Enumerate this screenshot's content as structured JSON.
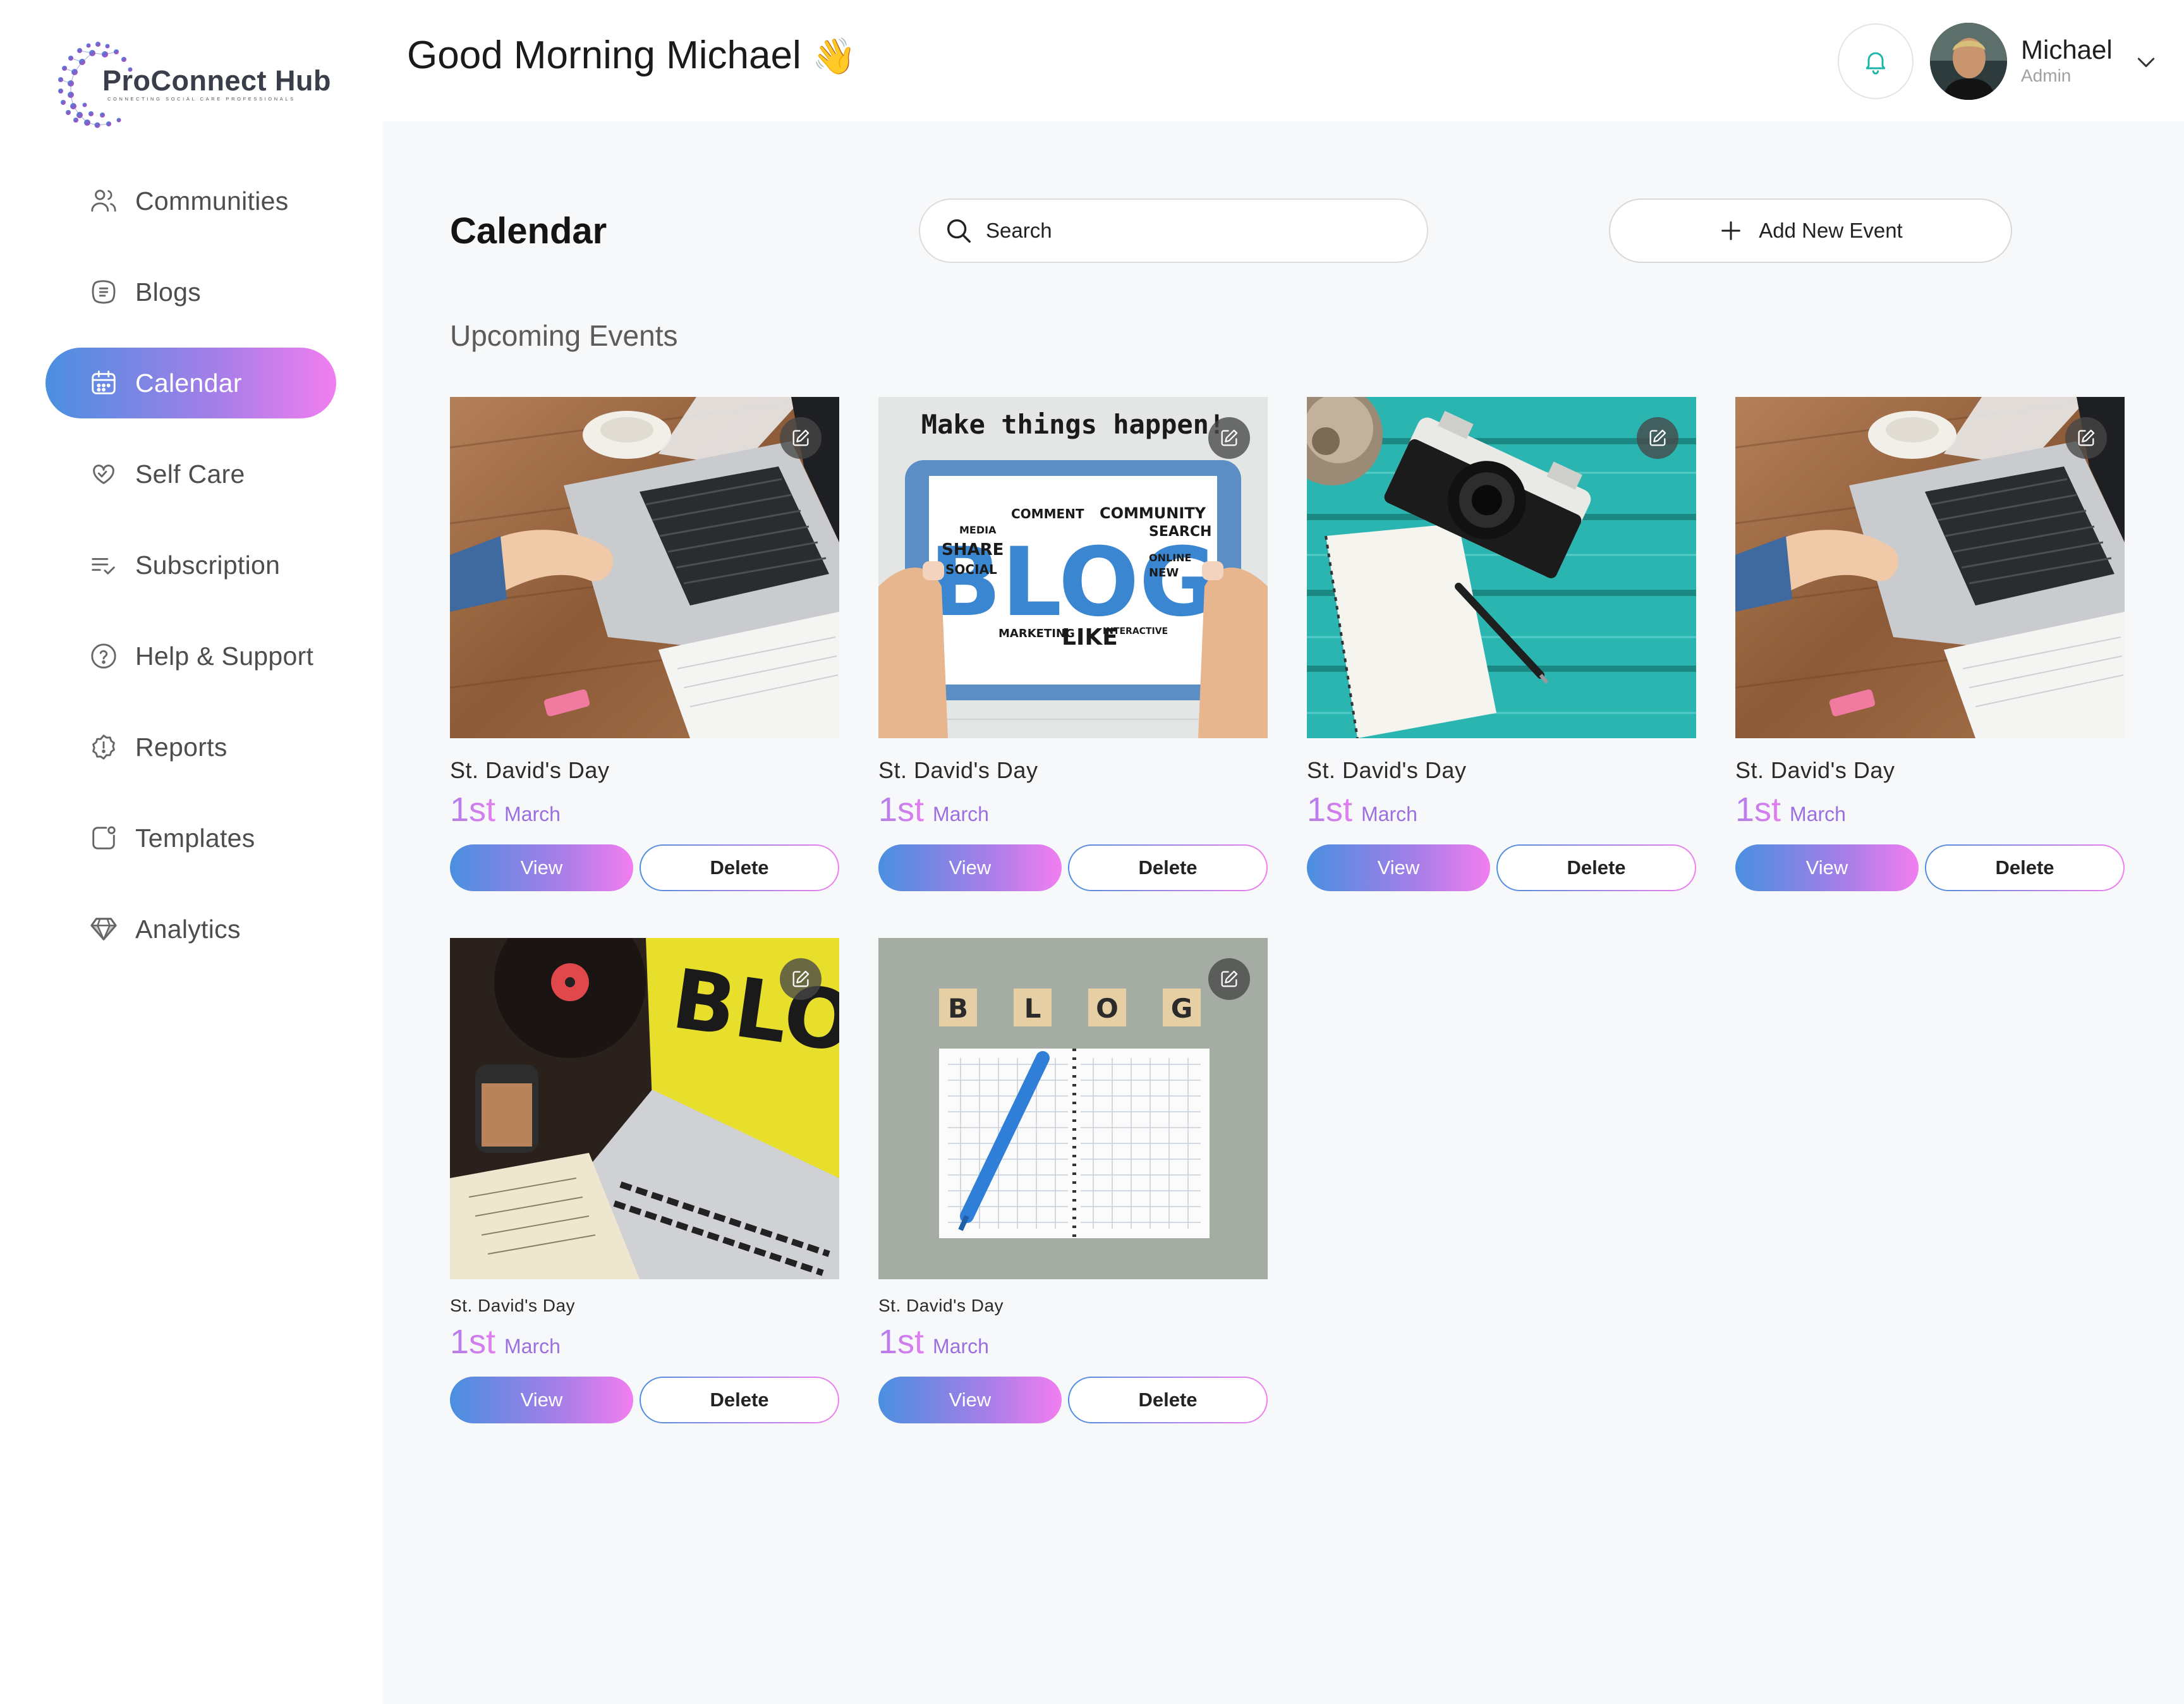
{
  "brand": {
    "name": "ProConnect Hub",
    "tagline": "CONNECTING SOCIAL CARE PROFESSIONALS"
  },
  "sidebar": {
    "items": [
      {
        "label": "Communities",
        "icon": "users-icon",
        "active": false
      },
      {
        "label": "Blogs",
        "icon": "blog-icon",
        "active": false
      },
      {
        "label": "Calendar",
        "icon": "calendar-icon",
        "active": true
      },
      {
        "label": "Self Care",
        "icon": "heart-hands-icon",
        "active": false
      },
      {
        "label": "Subscription",
        "icon": "list-check-icon",
        "active": false
      },
      {
        "label": "Help & Support",
        "icon": "question-circle-icon",
        "active": false
      },
      {
        "label": "Reports",
        "icon": "alert-badge-icon",
        "active": false
      },
      {
        "label": "Templates",
        "icon": "template-icon",
        "active": false
      },
      {
        "label": "Analytics",
        "icon": "diamond-icon",
        "active": false
      }
    ]
  },
  "header": {
    "greeting": "Good Morning Michael",
    "greeting_emoji": "👋",
    "user_name": "Michael",
    "user_role": "Admin"
  },
  "main": {
    "title": "Calendar",
    "search_placeholder": "Search",
    "add_button": "Add New Event",
    "section_title": "Upcoming Events",
    "view_label": "View",
    "delete_label": "Delete",
    "events": [
      {
        "title": "St. David's Day",
        "day": "1st",
        "month": "March",
        "image": "laptop-desk"
      },
      {
        "title": "St. David's Day",
        "day": "1st",
        "month": "March",
        "image": "blog-tablet",
        "image_text": "Make things happen!"
      },
      {
        "title": "St. David's Day",
        "day": "1st",
        "month": "March",
        "image": "camera-teal"
      },
      {
        "title": "St. David's Day",
        "day": "1st",
        "month": "March",
        "image": "laptop-desk"
      },
      {
        "title": "St. David's Day",
        "day": "1st",
        "month": "March",
        "image": "blog-laptop-yellow"
      },
      {
        "title": "St. David's Day",
        "day": "1st",
        "month": "March",
        "image": "blog-notebook",
        "image_letters": [
          "B",
          "L",
          "O",
          "G"
        ]
      }
    ]
  },
  "colors": {
    "accent_start": "#4a8fe0",
    "accent_mid": "#a77ee8",
    "accent_end": "#f27ef0",
    "bell": "#1bb6a8"
  }
}
